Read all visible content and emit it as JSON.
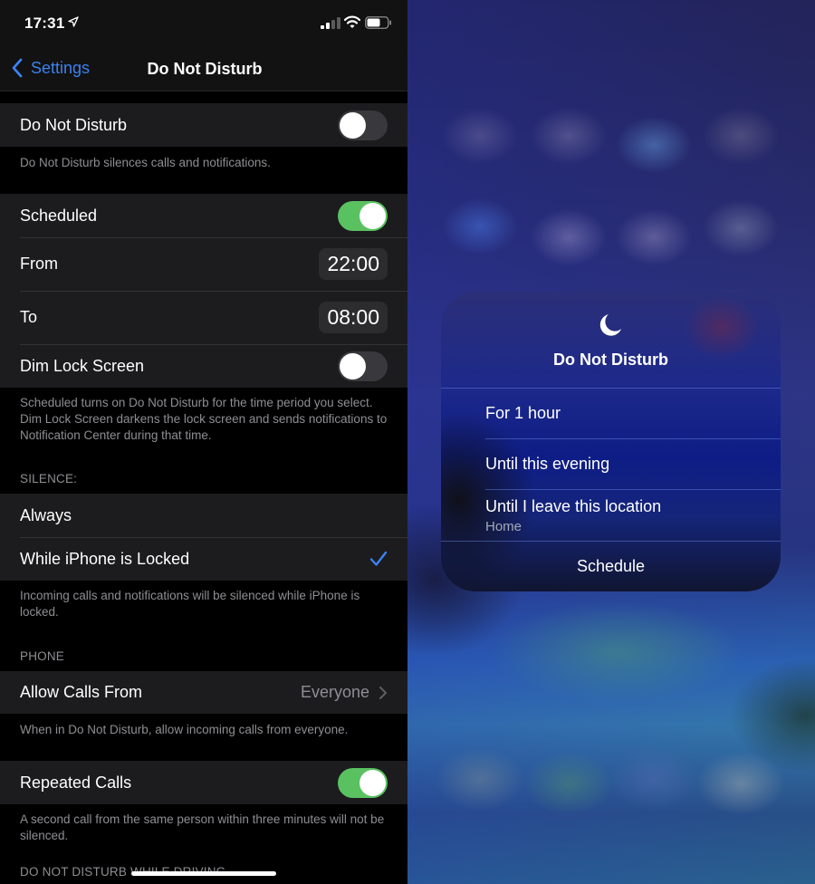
{
  "status_bar": {
    "time": "17:31",
    "location_icon": "location-arrow-icon",
    "signal_icon": "cellular-signal-icon",
    "wifi_icon": "wifi-icon",
    "battery_icon": "battery-icon"
  },
  "nav": {
    "back_label": "Settings",
    "title": "Do Not Disturb"
  },
  "sections": {
    "dnd": {
      "label": "Do Not Disturb",
      "enabled": false,
      "footer": "Do Not Disturb silences calls and notifications."
    },
    "schedule": {
      "scheduled_label": "Scheduled",
      "scheduled_enabled": true,
      "from_label": "From",
      "from_value": "22:00",
      "to_label": "To",
      "to_value": "08:00",
      "dim_label": "Dim Lock Screen",
      "dim_enabled": false,
      "footer": "Scheduled turns on Do Not Disturb for the time period you select. Dim Lock Screen darkens the lock screen and sends notifications to Notification Center during that time."
    },
    "silence": {
      "header": "SILENCE:",
      "always_label": "Always",
      "locked_label": "While iPhone is Locked",
      "selected": "While iPhone is Locked",
      "footer": "Incoming calls and notifications will be silenced while iPhone is locked."
    },
    "phone": {
      "header": "PHONE",
      "allow_label": "Allow Calls From",
      "allow_value": "Everyone",
      "allow_footer": "When in Do Not Disturb, allow incoming calls from everyone.",
      "repeated_label": "Repeated Calls",
      "repeated_enabled": true,
      "repeated_footer": "A second call from the same person within three minutes will not be silenced."
    },
    "driving": {
      "header": "DO NOT DISTURB WHILE DRIVING"
    }
  },
  "dnd_menu": {
    "icon": "moon-icon",
    "title": "Do Not Disturb",
    "options": [
      {
        "label": "For 1 hour"
      },
      {
        "label": "Until this evening"
      },
      {
        "label": "Until I leave this location",
        "sublabel": "Home"
      }
    ],
    "schedule_label": "Schedule"
  },
  "colors": {
    "accent_blue": "#3b82f0",
    "toggle_on": "#5ac160",
    "toggle_off": "#39393d",
    "cell_bg": "#1c1c1e",
    "secondary_text": "#8e8e93"
  }
}
